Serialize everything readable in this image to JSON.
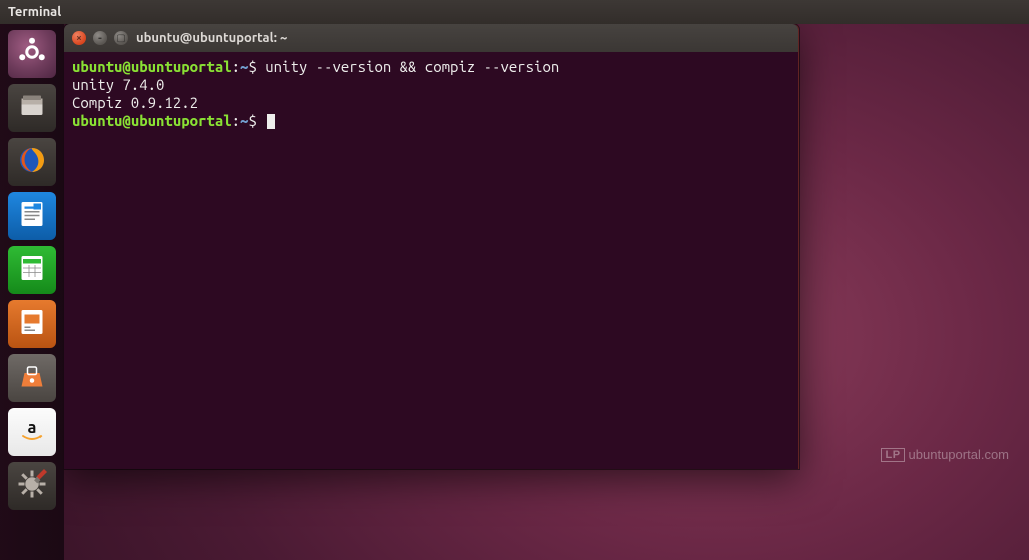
{
  "menubar": {
    "app": "Terminal"
  },
  "terminal": {
    "title": "ubuntu@ubuntuportal: ~",
    "prompt": {
      "user": "ubuntu",
      "at": "@",
      "host": "ubuntuportal",
      "colon": ":",
      "path": "~",
      "sigil": "$"
    },
    "command": "unity --version && compiz --version",
    "output": [
      "unity 7.4.0",
      "Compiz 0.9.12.2"
    ]
  },
  "watermark": {
    "badge": "LP",
    "text": "ubuntuportal.com"
  },
  "launcher": [
    {
      "name": "dash",
      "tile": "tile-dash",
      "icon": "ubuntu"
    },
    {
      "name": "files",
      "tile": "tile-dark",
      "icon": "files"
    },
    {
      "name": "firefox",
      "tile": "tile-dark",
      "icon": "firefox"
    },
    {
      "name": "writer",
      "tile": "tile-writer",
      "icon": "writer"
    },
    {
      "name": "calc",
      "tile": "tile-calc",
      "icon": "calc"
    },
    {
      "name": "impress",
      "tile": "tile-impress",
      "icon": "impress"
    },
    {
      "name": "software",
      "tile": "tile-software",
      "icon": "software"
    },
    {
      "name": "amazon",
      "tile": "tile-white",
      "icon": "amazon"
    },
    {
      "name": "settings",
      "tile": "tile-dark",
      "icon": "settings"
    }
  ]
}
